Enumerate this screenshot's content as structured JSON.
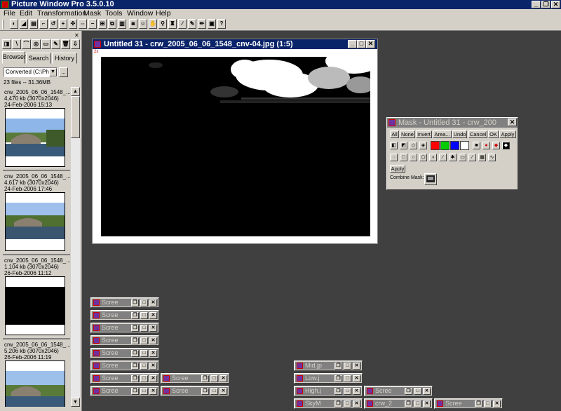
{
  "app": {
    "title": "Picture Window Pro 3.5.0.10"
  },
  "menu": [
    "File",
    "Edit",
    "Transformation",
    "Mask",
    "Tools",
    "Window",
    "Help"
  ],
  "browser": {
    "tabs": [
      "Browser",
      "Search",
      "History"
    ],
    "folder": "Converted (C:\\Photo",
    "browse_button": "...",
    "file_count": "23 files -- 31.36MB",
    "files": [
      {
        "name": "crw_2005_06_06_1548_...",
        "size": "4,470 kb (3070x2046)",
        "date": "24-Feb-2006 15:13"
      },
      {
        "name": "crw_2005_06_06_1548_...",
        "size": "4,617 kb (3070x2046)",
        "date": "24-Feb-2006 17:46"
      },
      {
        "name": "crw_2005_06_06_1548_...",
        "size": "1,104 kb (3070x2046)",
        "date": "26-Feb-2006 11:12"
      },
      {
        "name": "crw_2005_06_06_1548_...",
        "size": "5,206 kb (3070x2046)",
        "date": "26-Feb-2006 11:19"
      }
    ]
  },
  "image_window": {
    "title": "Untitled 31 - crw_2005_06_06_1548_cnv-04.jpg (1:5)",
    "ruler": "2x"
  },
  "mask_window": {
    "title": "Mask - Untitled 31 - crw_200",
    "buttons": [
      "All",
      "None",
      "Invert",
      "Area...",
      "Undo",
      "Cancel",
      "OK",
      "Apply"
    ],
    "apply_button": "Apply",
    "combine_label": "Combine Mask:",
    "swatch_colors": [
      "#ff0000",
      "#00cc00",
      "#0000ff",
      "#ffffff"
    ]
  },
  "minimized_windows": [
    "Scree",
    "Scree",
    "Scree",
    "Scree",
    "Scree",
    "Scree",
    "Scree",
    "Scree",
    "Scree",
    "Scree",
    "Mid.jp",
    "Low.j",
    "High.j",
    "Scree",
    "SkyM",
    "crw_2",
    "Scree"
  ]
}
